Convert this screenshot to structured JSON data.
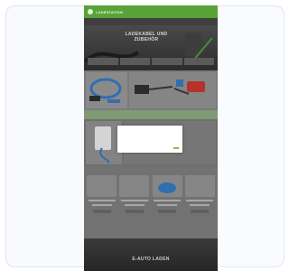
{
  "site": {
    "logo_text": "LADESTATION",
    "nav": [
      "",
      "",
      "",
      "",
      ""
    ],
    "hero": {
      "title_line1": "LADEKABEL UND",
      "title_line2": "ZUBEHÖR",
      "tabs": [
        "",
        "",
        "",
        ""
      ]
    },
    "strip_text": "",
    "features": {
      "title": ""
    },
    "bottom_text": "E-AUTO LADEN"
  },
  "dialog": {
    "text": "",
    "link_label": "",
    "accept_label": ""
  },
  "colors": {
    "header_green": "#58a336",
    "accept_green": "#79c04c",
    "overlay_gray": "#6f6f6f"
  }
}
